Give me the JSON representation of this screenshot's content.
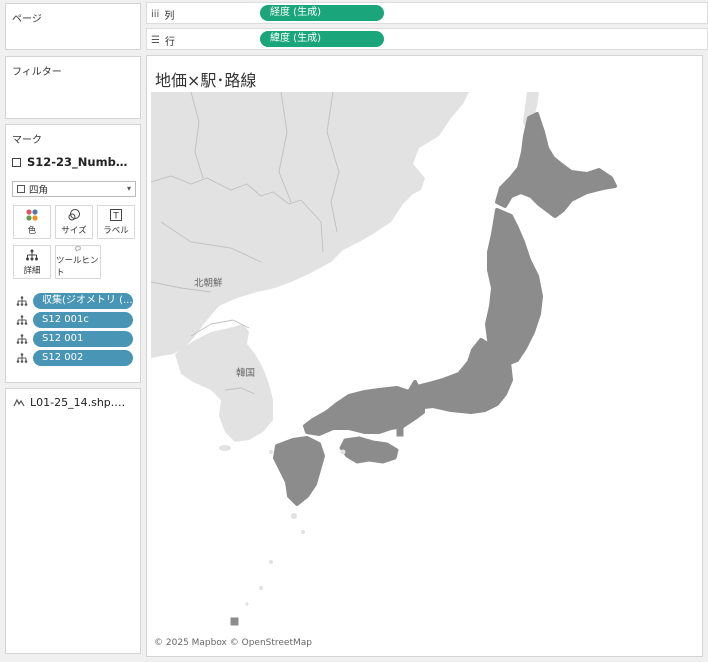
{
  "shelves": {
    "pages_label": "ページ",
    "filters_label": "フィルター",
    "columns": {
      "label": "列",
      "icon": "columns-icon",
      "pill": "経度 (生成)",
      "pill_color": "#1aa67a"
    },
    "rows": {
      "label": "行",
      "icon": "rows-icon",
      "pill": "緯度 (生成)",
      "pill_color": "#1aa67a"
    }
  },
  "marks": {
    "title": "マーク",
    "layer_name": "S12-23_Numb…",
    "mark_type": "四角",
    "buttons": [
      {
        "label": "色",
        "icon": "color-dots-icon"
      },
      {
        "label": "サイズ",
        "icon": "size-circles-icon"
      },
      {
        "label": "ラベル",
        "icon": "label-t-icon"
      },
      {
        "label": "詳細",
        "icon": "detail-tree-icon"
      },
      {
        "label": "ツールヒント",
        "icon": "tooltip-bubble-icon"
      }
    ],
    "fields": [
      {
        "label": "収集(ジオメトリ (..."
      },
      {
        "label": "S12 001c"
      },
      {
        "label": "S12 001"
      },
      {
        "label": "S12 002"
      }
    ],
    "pill_color": "#4995b6",
    "layer2_name": "L01-25_14.shp.…"
  },
  "view": {
    "title": "地価×駅･路線",
    "map_labels": {
      "north_korea": "北朝鮮",
      "south_korea": "韓国"
    },
    "attribution": "© 2025 Mapbox © OpenStreetMap"
  }
}
